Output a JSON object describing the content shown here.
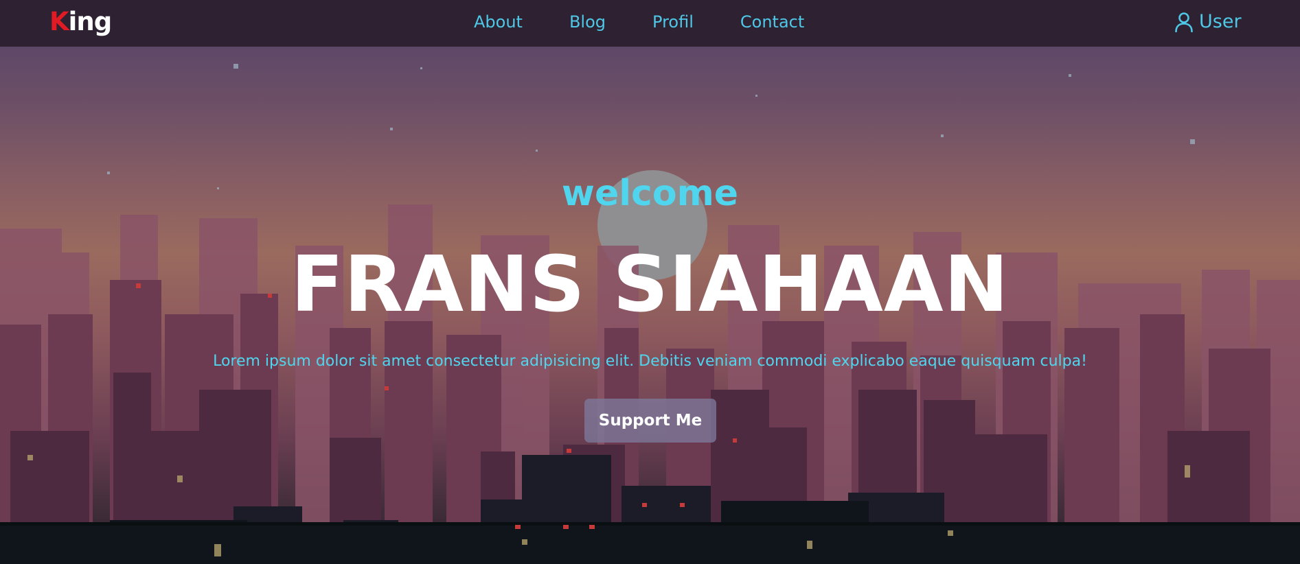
{
  "brand": {
    "initial": "K",
    "rest": "ing"
  },
  "nav": {
    "links": [
      {
        "label": "About"
      },
      {
        "label": "Blog"
      },
      {
        "label": "Profil"
      },
      {
        "label": "Contact"
      }
    ],
    "user_label": "User",
    "user_icon": "user-icon"
  },
  "hero": {
    "welcome": "welcome",
    "name": "FRANS SIAHAAN",
    "description": "Lorem ipsum dolor sit amet consectetur adipisicing elit. Debitis veniam commodi explicabo eaque quisquam culpa!",
    "button_label": "Support Me"
  },
  "colors": {
    "accent": "#4fd6ee",
    "logo_initial": "#e01b24",
    "navbar_bg": "#2d2132",
    "button_bg": "#7d789b"
  }
}
